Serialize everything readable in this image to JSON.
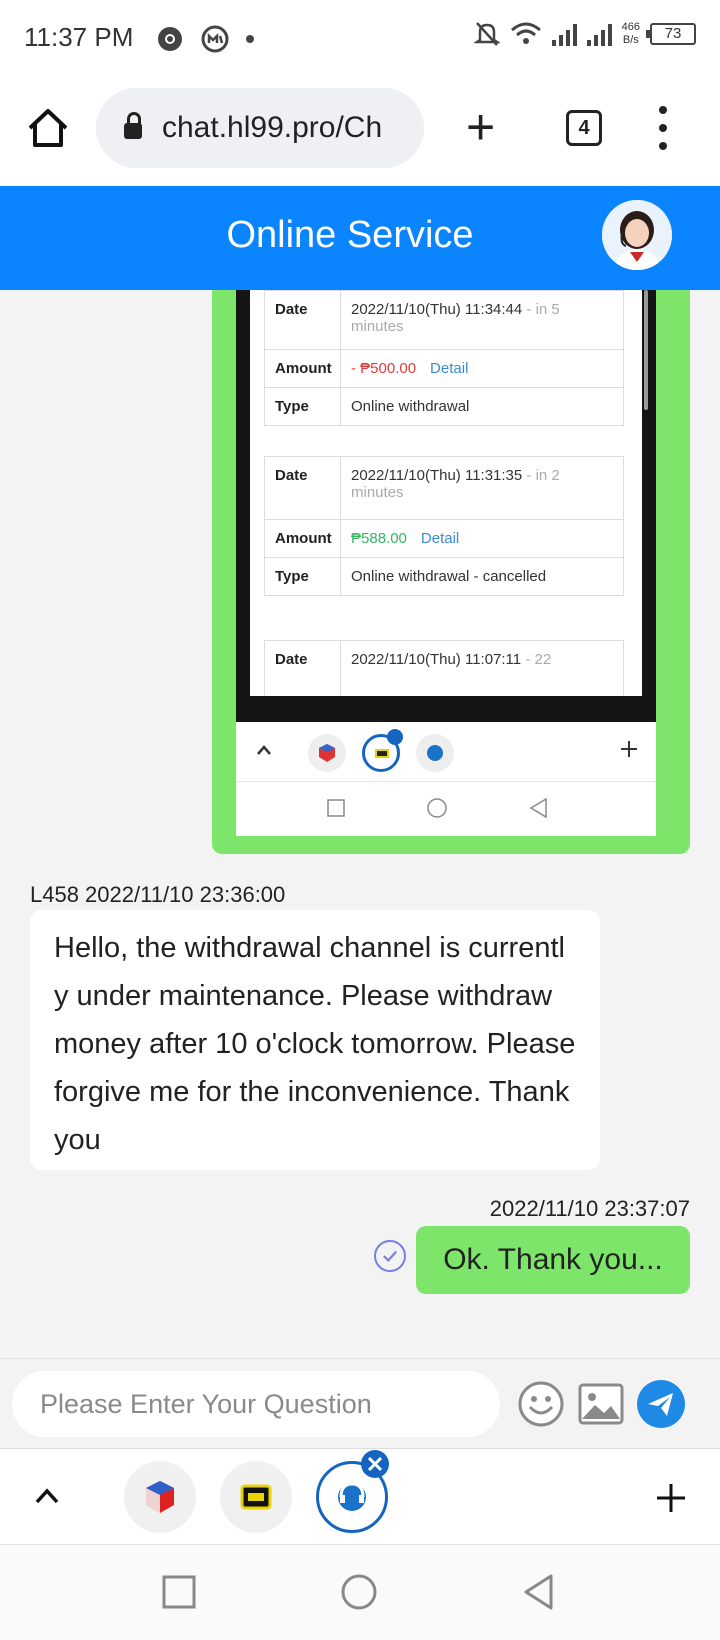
{
  "status_bar": {
    "time": "11:37 PM",
    "net_speed_value": "466",
    "net_speed_unit": "B/s",
    "battery": "73"
  },
  "browser": {
    "url": "chat.hl99.pro/Ch",
    "tab_count": "4"
  },
  "header": {
    "title": "Online Service"
  },
  "shared_screenshot": {
    "records": [
      {
        "date_label": "Date",
        "date_value": "2022/11/10(Thu) 11:34:44",
        "date_ago": "- in 5 minutes",
        "amount_label": "Amount",
        "amount_value": "- ₱500.00",
        "detail_label": "Detail",
        "type_label": "Type",
        "type_value": "Online withdrawal"
      },
      {
        "date_label": "Date",
        "date_value": "2022/11/10(Thu) 11:31:35",
        "date_ago": "- in 2 minutes",
        "amount_label": "Amount",
        "amount_value": "₱588.00",
        "detail_label": "Detail",
        "type_label": "Type",
        "type_value": "Online withdrawal - cancelled"
      },
      {
        "date_label": "Date",
        "date_value": "2022/11/10(Thu) 11:07:11",
        "date_ago": "- 22"
      }
    ]
  },
  "messages": [
    {
      "sender": "agent",
      "meta": "L458 2022/11/10 23:36:00",
      "text": "Hello, the withdrawal channel is currently under maintenance. Please withdraw money after 10 o'clock tomorrow. Please forgive me for the inconvenience. Thank you"
    },
    {
      "sender": "user",
      "meta": "2022/11/10 23:37:07",
      "text": "Ok. Thank you..."
    }
  ],
  "input": {
    "placeholder": "Please Enter Your Question"
  },
  "icons": {
    "status": [
      "chrome-icon",
      "circle-m-icon",
      "dot-icon",
      "mute-bell-icon",
      "wifi-icon",
      "signal-icon",
      "battery-icon"
    ],
    "browser": [
      "home-icon",
      "lock-icon",
      "plus-icon",
      "tabs-icon",
      "more-vert-icon"
    ],
    "input_tools": [
      "emoji-icon",
      "image-icon",
      "send-icon"
    ],
    "app_tabs": [
      "chevron-up-icon",
      "app-cube-icon",
      "app-ticket-icon",
      "support-agent-icon",
      "close-badge-icon",
      "plus-icon"
    ],
    "system_nav": [
      "recents-icon",
      "home-circle-icon",
      "back-icon"
    ]
  },
  "colors": {
    "header_blue": "#0a84ff",
    "bubble_green": "#7de66a",
    "amount_red": "#e03b3b",
    "amount_green": "#32b760",
    "send_blue": "#1f8ae6"
  }
}
